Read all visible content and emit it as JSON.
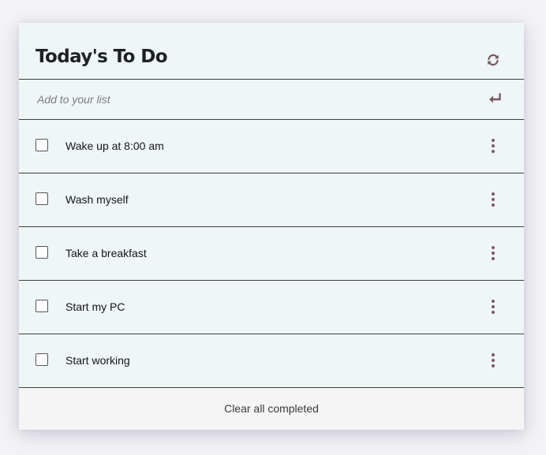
{
  "header": {
    "title": "Today's To Do",
    "refresh_icon": "refresh-icon"
  },
  "add": {
    "placeholder": "Add to your list",
    "value": "",
    "enter_icon": "return-arrow-icon"
  },
  "todos": [
    {
      "text": "Wake up at 8:00 am",
      "completed": false
    },
    {
      "text": "Wash myself",
      "completed": false
    },
    {
      "text": "Take a breakfast",
      "completed": false
    },
    {
      "text": "Start my PC",
      "completed": false
    },
    {
      "text": "Start working",
      "completed": false
    }
  ],
  "footer": {
    "clear_label": "Clear all completed"
  },
  "colors": {
    "card_background": "#eef6f8",
    "accent_icon": "#7a5a5f",
    "footer_background": "#f5f5f5"
  }
}
